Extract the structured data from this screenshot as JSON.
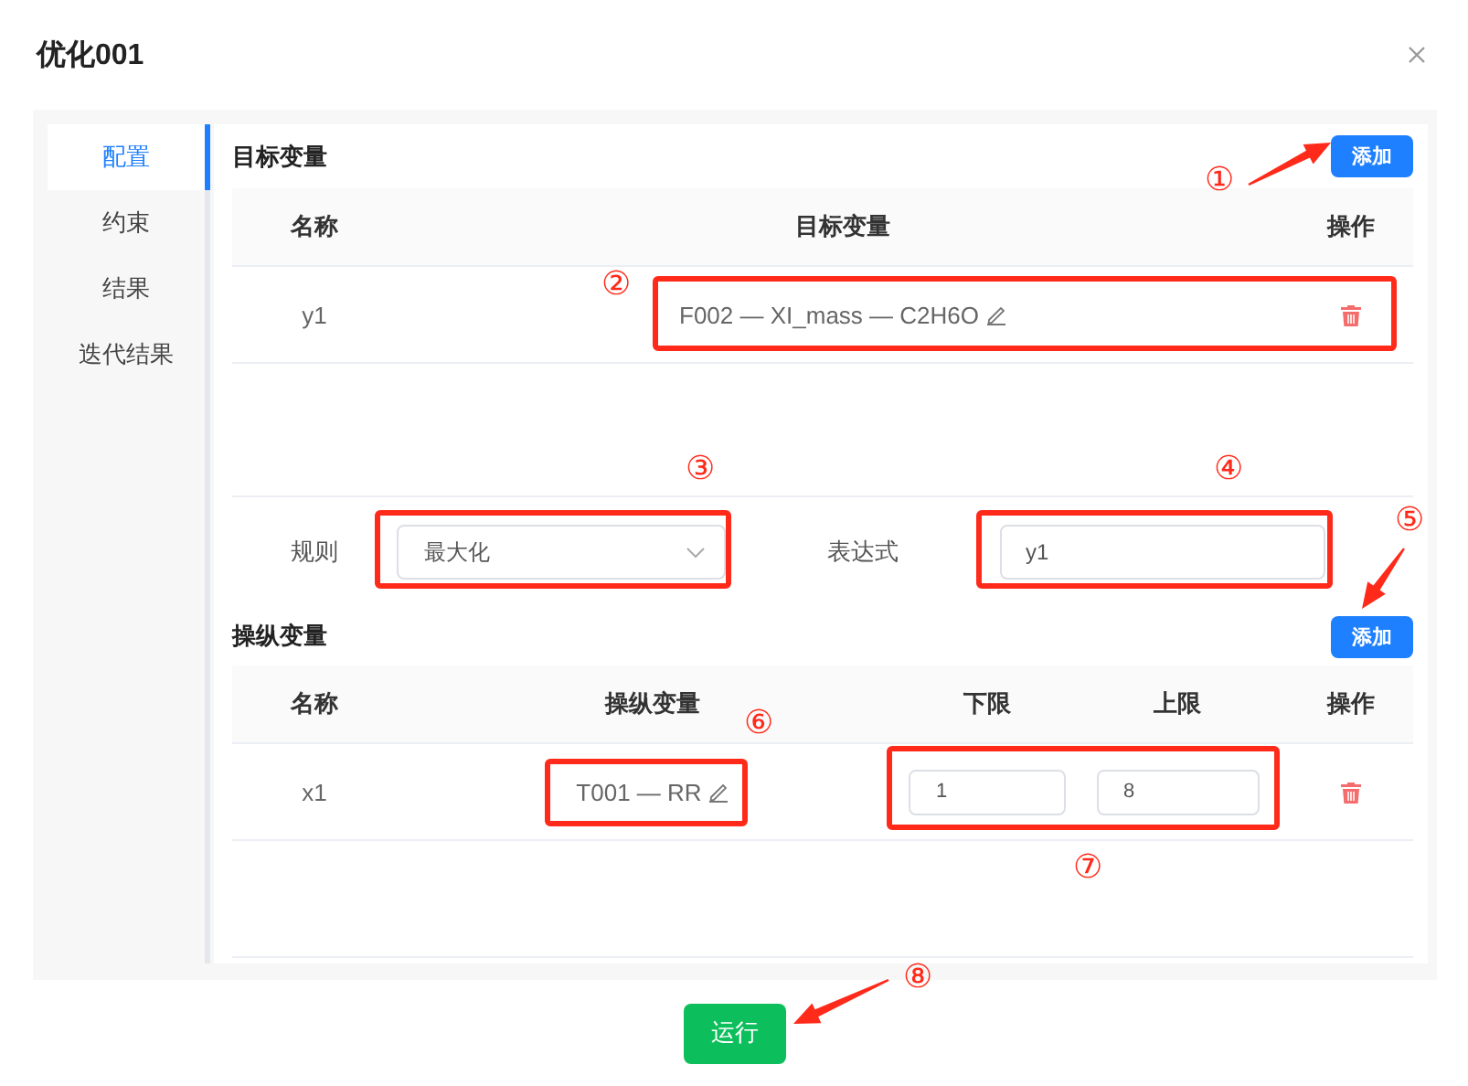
{
  "dialog": {
    "title": "优化001"
  },
  "sidebar": {
    "items": [
      {
        "label": "配置",
        "selected": true
      },
      {
        "label": "约束",
        "selected": false
      },
      {
        "label": "结果",
        "selected": false
      },
      {
        "label": "迭代结果",
        "selected": false
      }
    ]
  },
  "objective": {
    "heading": "目标变量",
    "add_button": "添加",
    "columns": [
      "名称",
      "目标变量",
      "操作"
    ],
    "rows": [
      {
        "name": "y1",
        "variable": "F002 — XI_mass — C2H6O"
      }
    ],
    "rule_label": "规则",
    "rule_value": "最大化",
    "expression_label": "表达式",
    "expression_value": "y1"
  },
  "manipulated": {
    "heading": "操纵变量",
    "add_button": "添加",
    "columns": [
      "名称",
      "操纵变量",
      "下限",
      "上限",
      "操作"
    ],
    "rows": [
      {
        "name": "x1",
        "variable": "T001 — RR",
        "lower": "1",
        "upper": "8"
      }
    ]
  },
  "run_button": "运行",
  "annotations": [
    "①",
    "②",
    "③",
    "④",
    "⑤",
    "⑥",
    "⑦",
    "⑧"
  ]
}
